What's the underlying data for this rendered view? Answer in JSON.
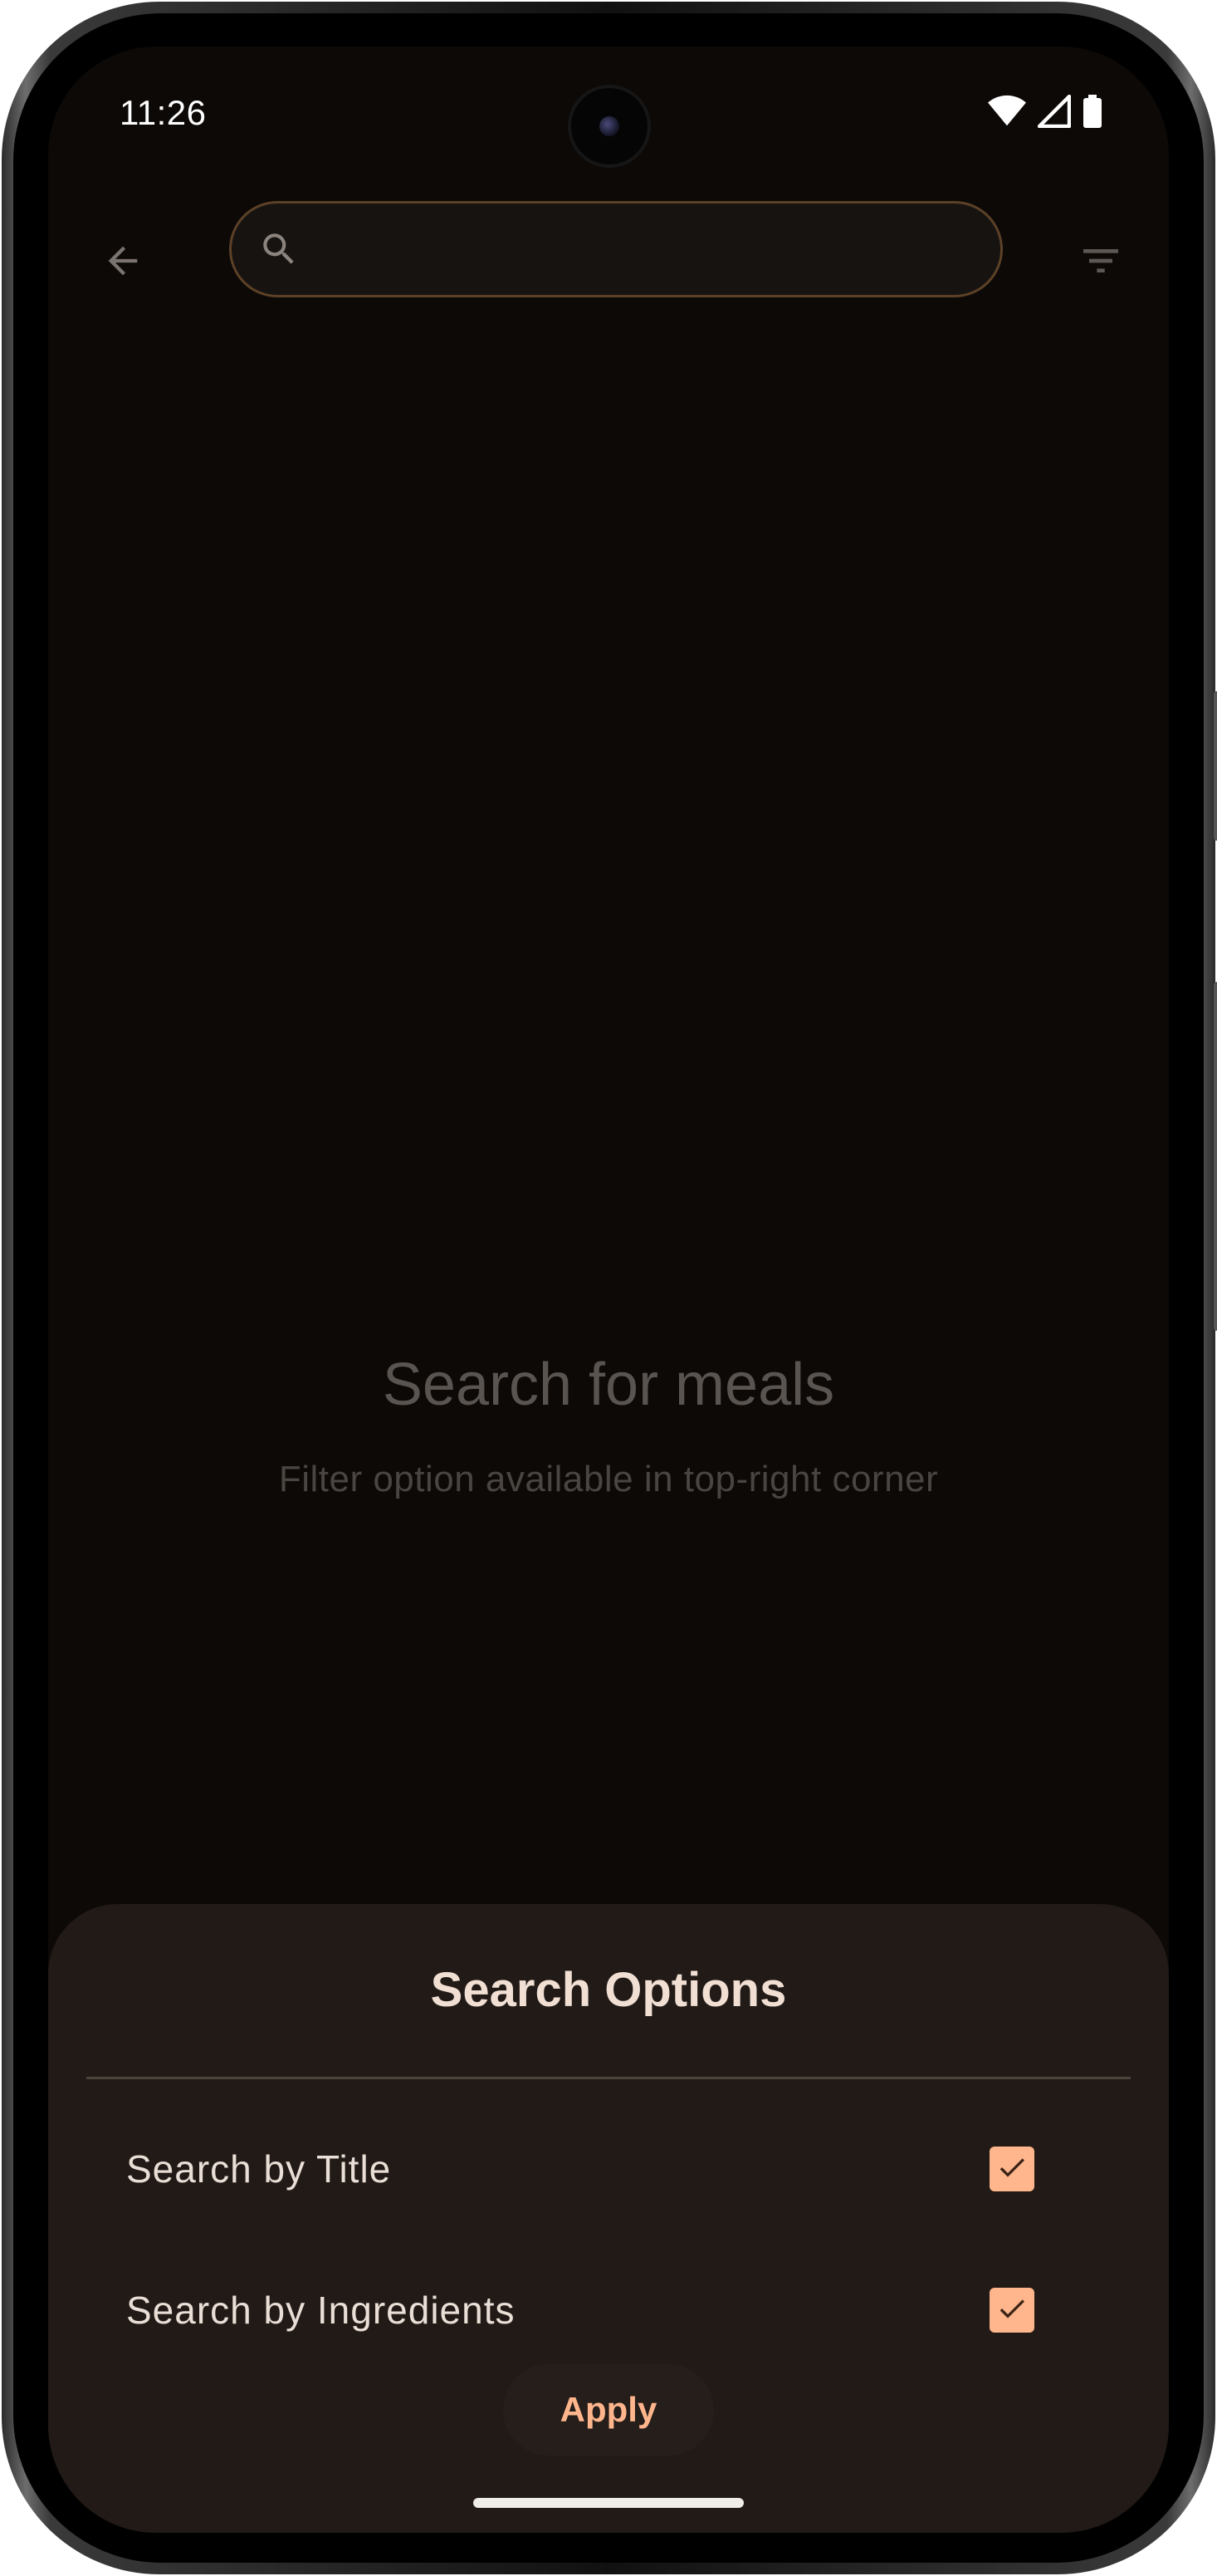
{
  "status_bar": {
    "time": "11:26",
    "icons": [
      "wifi-icon",
      "cellular-signal-icon",
      "battery-icon"
    ]
  },
  "top_bar": {
    "back_icon": "arrow-back-icon",
    "search": {
      "icon": "search-icon",
      "value": "",
      "placeholder": ""
    },
    "filter_icon": "filter-list-icon"
  },
  "empty_state": {
    "title": "Search for meals",
    "subtitle": "Filter option available in top-right corner"
  },
  "search_options_sheet": {
    "title": "Search Options",
    "options": [
      {
        "label": "Search by Title",
        "checked": true
      },
      {
        "label": "Search by Ingredients",
        "checked": true
      }
    ],
    "apply_label": "Apply"
  },
  "colors": {
    "background": "#0c0907",
    "sheet_background": "#211a16",
    "accent": "#ffb68c",
    "search_border": "#5c4127"
  }
}
